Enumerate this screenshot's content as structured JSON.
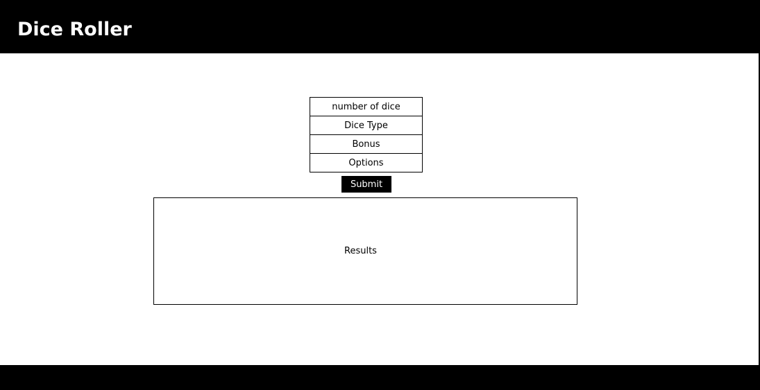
{
  "header": {
    "title": "Dice Roller"
  },
  "form": {
    "fields": [
      {
        "label": "number of dice"
      },
      {
        "label": "Dice Type"
      },
      {
        "label": "Bonus"
      },
      {
        "label": "Options"
      }
    ],
    "submit_label": "Submit"
  },
  "results": {
    "label": "Results"
  },
  "colors": {
    "header_bg": "#000000",
    "footer_bg": "#000000",
    "page_bg": "#ffffff",
    "button_bg": "#000000"
  }
}
